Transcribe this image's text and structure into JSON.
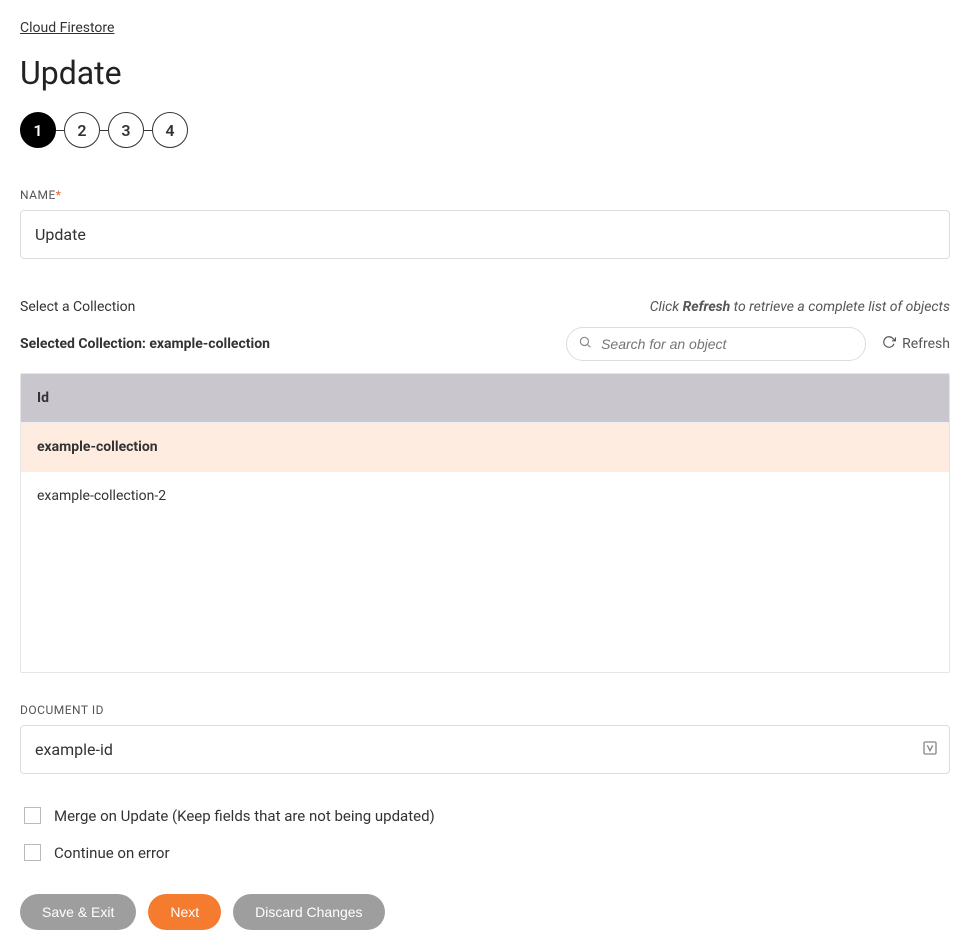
{
  "breadcrumb": {
    "label": "Cloud Firestore"
  },
  "page": {
    "title": "Update"
  },
  "stepper": {
    "steps": [
      "1",
      "2",
      "3",
      "4"
    ],
    "active_index": 0
  },
  "name_field": {
    "label": "NAME",
    "required_mark": "*",
    "value": "Update"
  },
  "collection_section": {
    "label": "Select a Collection",
    "hint_prefix": "Click ",
    "hint_bold": "Refresh",
    "hint_suffix": " to retrieve a complete list of objects",
    "selected_prefix": "Selected Collection: ",
    "selected_value": "example-collection",
    "search_placeholder": "Search for an object",
    "refresh_label": "Refresh"
  },
  "table": {
    "header": "Id",
    "rows": [
      {
        "id": "example-collection",
        "selected": true
      },
      {
        "id": "example-collection-2",
        "selected": false
      }
    ]
  },
  "document_id": {
    "label": "DOCUMENT ID",
    "value": "example-id"
  },
  "options": {
    "merge_label": "Merge on Update (Keep fields that are not being updated)",
    "continue_label": "Continue on error"
  },
  "buttons": {
    "save_exit": "Save & Exit",
    "next": "Next",
    "discard": "Discard Changes"
  }
}
